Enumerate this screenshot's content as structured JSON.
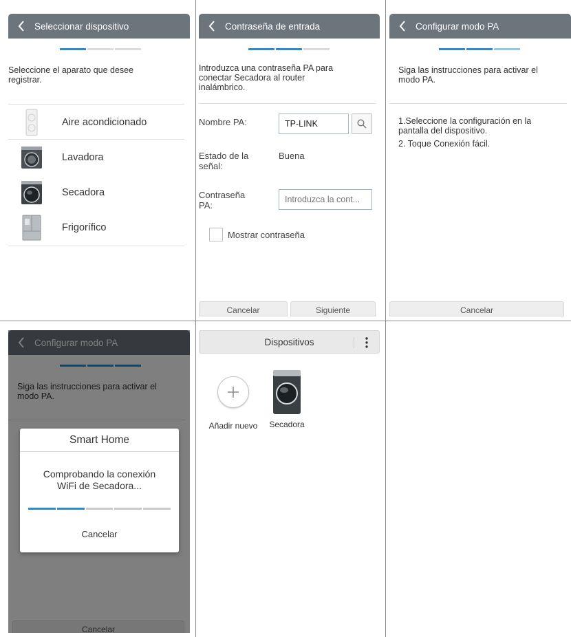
{
  "panel1": {
    "title": "Seleccionar dispositivo",
    "progress": [
      "on",
      "off",
      "off"
    ],
    "instruction": "Seleccione el aparato que desee registrar.",
    "devices": [
      {
        "label": "Aire acondicionado",
        "icon": "air-conditioner-icon"
      },
      {
        "label": "Lavadora",
        "icon": "washer-icon"
      },
      {
        "label": "Secadora",
        "icon": "dryer-icon"
      },
      {
        "label": "Frigorífico",
        "icon": "refrigerator-icon"
      }
    ]
  },
  "panel2": {
    "title": "Contraseña de entrada",
    "progress": [
      "on",
      "on",
      "off"
    ],
    "instruction": "Introduzca una contraseña PA para conectar Secadora al router inalámbrico.",
    "ap_name_label": "Nombre PA:",
    "ap_name_value": "TP-LINK",
    "signal_label": "Estado de la señal:",
    "signal_value": "Buena",
    "password_label": "Contraseña PA:",
    "password_placeholder": "Introduzca la cont...",
    "show_password_label": "Mostrar contraseña",
    "cancel_label": "Cancelar",
    "next_label": "Siguiente"
  },
  "panel3": {
    "title": "Configurar modo PA",
    "progress": [
      "on",
      "on",
      "light"
    ],
    "instruction": "Siga las instrucciones para activar el modo PA.",
    "step1": "1.Seleccione la configuración en la pantalla del dispositivo.",
    "step2": "2. Toque Conexión fácil.",
    "cancel_label": "Cancelar"
  },
  "panel4": {
    "title": "Configurar modo PA",
    "progress": [
      "on",
      "on",
      "on"
    ],
    "instruction": "Siga las instrucciones para activar el modo PA.",
    "cancel_label": "Cancelar",
    "dialog": {
      "title": "Smart Home",
      "message": "Comprobando la conexión WiFi de Secadora...",
      "progress_segments": [
        "on",
        "on",
        "off",
        "off",
        "off"
      ],
      "cancel_label": "Cancelar"
    }
  },
  "panel5": {
    "title": "Dispositivos",
    "add_label": "Añadir nuevo",
    "device_label": "Secadora"
  },
  "colors": {
    "appbar": "#6d757c",
    "accent": "#2d8bc8",
    "accent_light": "#8ccbe6"
  }
}
